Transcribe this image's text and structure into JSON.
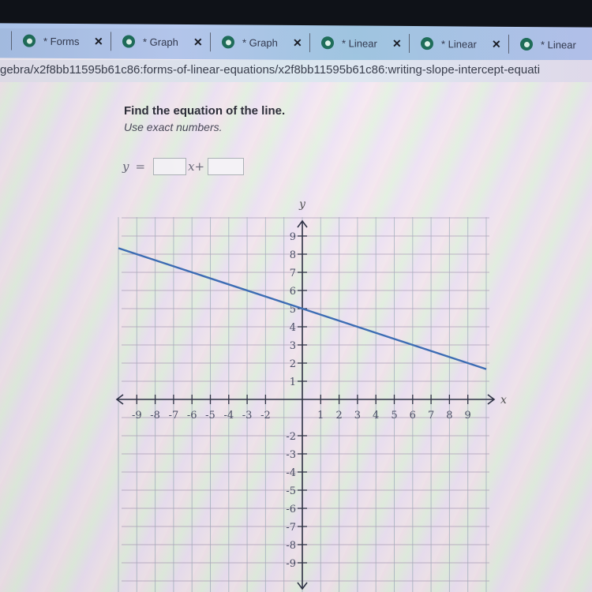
{
  "browser": {
    "tabs": [
      {
        "label": "* Forms",
        "close": "✕"
      },
      {
        "label": "* Graph",
        "close": "✕"
      },
      {
        "label": "* Graph",
        "close": "✕"
      },
      {
        "label": "* Linear",
        "close": "✕"
      },
      {
        "label": "* Linear",
        "close": "✕"
      },
      {
        "label": "* Linear",
        "close": "✕"
      }
    ],
    "url": "gebra/x2f8bb11595b61c86:forms-of-linear-equations/x2f8bb11595b61c86:writing-slope-intercept-equati"
  },
  "question": {
    "prompt": "Find the equation of the line.",
    "hint": "Use exact numbers.",
    "equation": {
      "lhs": "y",
      "equals": "=",
      "x_var": "x",
      "plus": "+",
      "slope_value": "",
      "intercept_value": ""
    }
  },
  "chart_data": {
    "type": "line",
    "title": "",
    "xlabel": "x",
    "ylabel": "y",
    "xlim": [
      -10,
      10
    ],
    "ylim": [
      -10,
      10
    ],
    "grid": true,
    "x_ticks": [
      -9,
      -8,
      -7,
      -6,
      -5,
      -4,
      -3,
      -2,
      1,
      2,
      3,
      4,
      5,
      6,
      7,
      8,
      9
    ],
    "y_ticks": [
      9,
      8,
      7,
      6,
      5,
      4,
      3,
      2,
      1,
      -2,
      -3,
      -4,
      -5,
      -6,
      -7,
      -8,
      -9
    ],
    "series": [
      {
        "name": "line",
        "color": "#3e6fb8",
        "points": [
          [
            -10,
            8.333
          ],
          [
            0,
            5
          ],
          [
            10,
            1.667
          ]
        ]
      }
    ]
  }
}
